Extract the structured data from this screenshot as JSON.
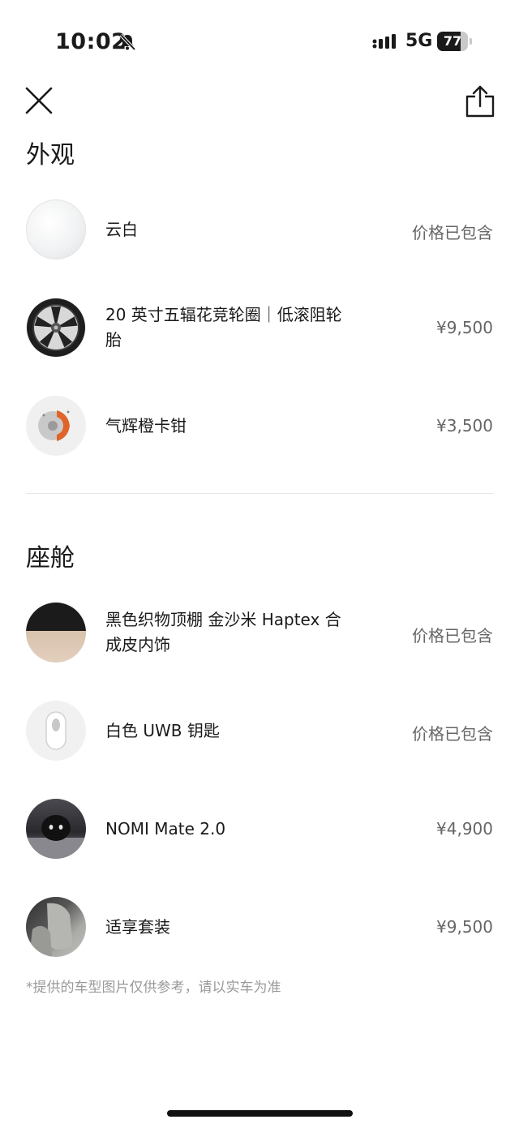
{
  "status_bar": {
    "time": "10:02",
    "network": "5G",
    "battery": "77",
    "battery_level": 0.77
  },
  "header": {
    "close_icon": "close-icon",
    "share_icon": "share-icon"
  },
  "sections": [
    {
      "title": "外观",
      "items": [
        {
          "name": "云白",
          "price": "价格已包含"
        },
        {
          "name": "20 英寸五辐花竞轮圈｜低滚阻轮胎",
          "price": "¥9,500"
        },
        {
          "name": "气辉橙卡钳",
          "price": "¥3,500"
        }
      ]
    },
    {
      "title": "座舱",
      "items": [
        {
          "name": "黑色织物顶棚 金沙米 Haptex 合成皮内饰",
          "price": "价格已包含"
        },
        {
          "name": "白色 UWB 钥匙",
          "price": "价格已包含"
        },
        {
          "name": "NOMI Mate 2.0",
          "price": "¥4,900"
        },
        {
          "name": "适享套装",
          "price": "¥9,500"
        }
      ]
    }
  ],
  "disclaimer": "*提供的车型图片仅供参考，请以实车为准",
  "colors": {
    "text": "#1a1a1a",
    "price": "#666666",
    "muted": "#9a9a9a",
    "divider": "#e6e6e6"
  }
}
